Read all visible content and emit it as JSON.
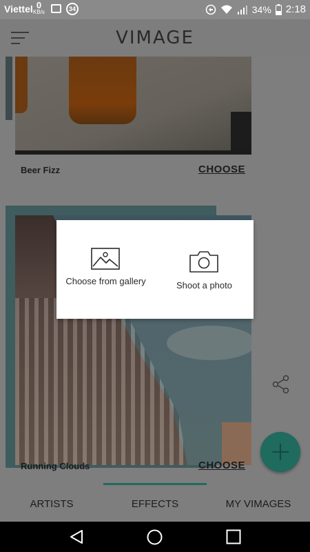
{
  "status_bar": {
    "carrier": "Viettel",
    "data_speed": "0",
    "data_unit": "KB/s",
    "notification_count": "34",
    "battery": "34%",
    "time": "2:18"
  },
  "header": {
    "title": "VIMAGE"
  },
  "cards": [
    {
      "name": "Beer Fizz",
      "choose_label": "CHOOSE"
    },
    {
      "name": "Running Clouds",
      "choose_label": "CHOOSE"
    }
  ],
  "dialog": {
    "gallery_label": "Choose from gallery",
    "camera_label": "Shoot a photo"
  },
  "tabs": [
    {
      "label": "ARTISTS",
      "active": false
    },
    {
      "label": "EFFECTS",
      "active": true
    },
    {
      "label": "MY VIMAGES",
      "active": false
    }
  ],
  "colors": {
    "accent": "#1f6b5e",
    "scrim": "#7e7e7e"
  },
  "icons": {
    "menu": "menu-icon",
    "share": "share-icon",
    "add": "plus-icon",
    "gallery": "image-icon",
    "camera": "camera-icon",
    "back": "back-icon",
    "home": "home-icon",
    "recents": "recents-icon"
  }
}
